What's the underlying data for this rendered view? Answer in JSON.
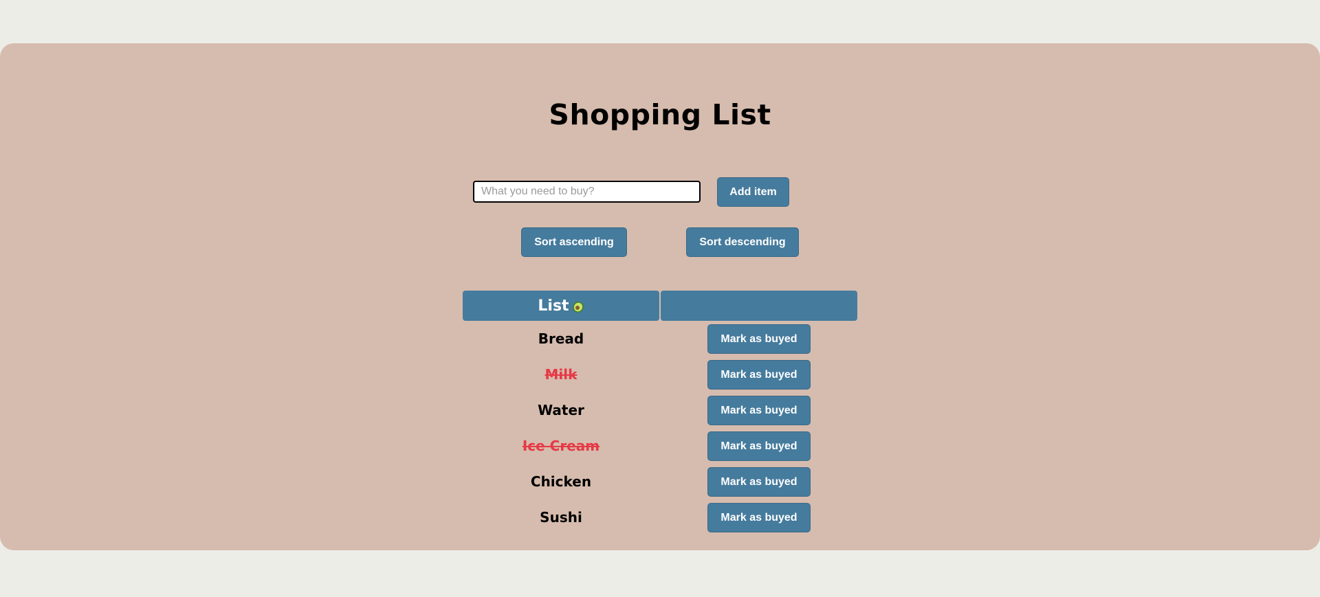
{
  "title": "Shopping List",
  "input": {
    "placeholder": "What you need to buy?",
    "value": ""
  },
  "add_button": "Add item",
  "sort_ascending": "Sort ascending",
  "sort_descending": "Sort descending",
  "table": {
    "header_list": "List",
    "header_icon": "avocado-icon",
    "header_actions": ""
  },
  "items": [
    {
      "name": "Bread",
      "bought": false,
      "action": "Mark as buyed"
    },
    {
      "name": "Milk",
      "bought": true,
      "action": "Mark as buyed"
    },
    {
      "name": "Water",
      "bought": false,
      "action": "Mark as buyed"
    },
    {
      "name": "Ice Cream",
      "bought": true,
      "action": "Mark as buyed"
    },
    {
      "name": "Chicken",
      "bought": false,
      "action": "Mark as buyed"
    },
    {
      "name": "Sushi",
      "bought": false,
      "action": "Mark as buyed"
    }
  ],
  "colors": {
    "page_bg": "#edede8",
    "card_bg": "#d6bcae",
    "accent": "#457b9d",
    "bought_text": "#e63946"
  }
}
